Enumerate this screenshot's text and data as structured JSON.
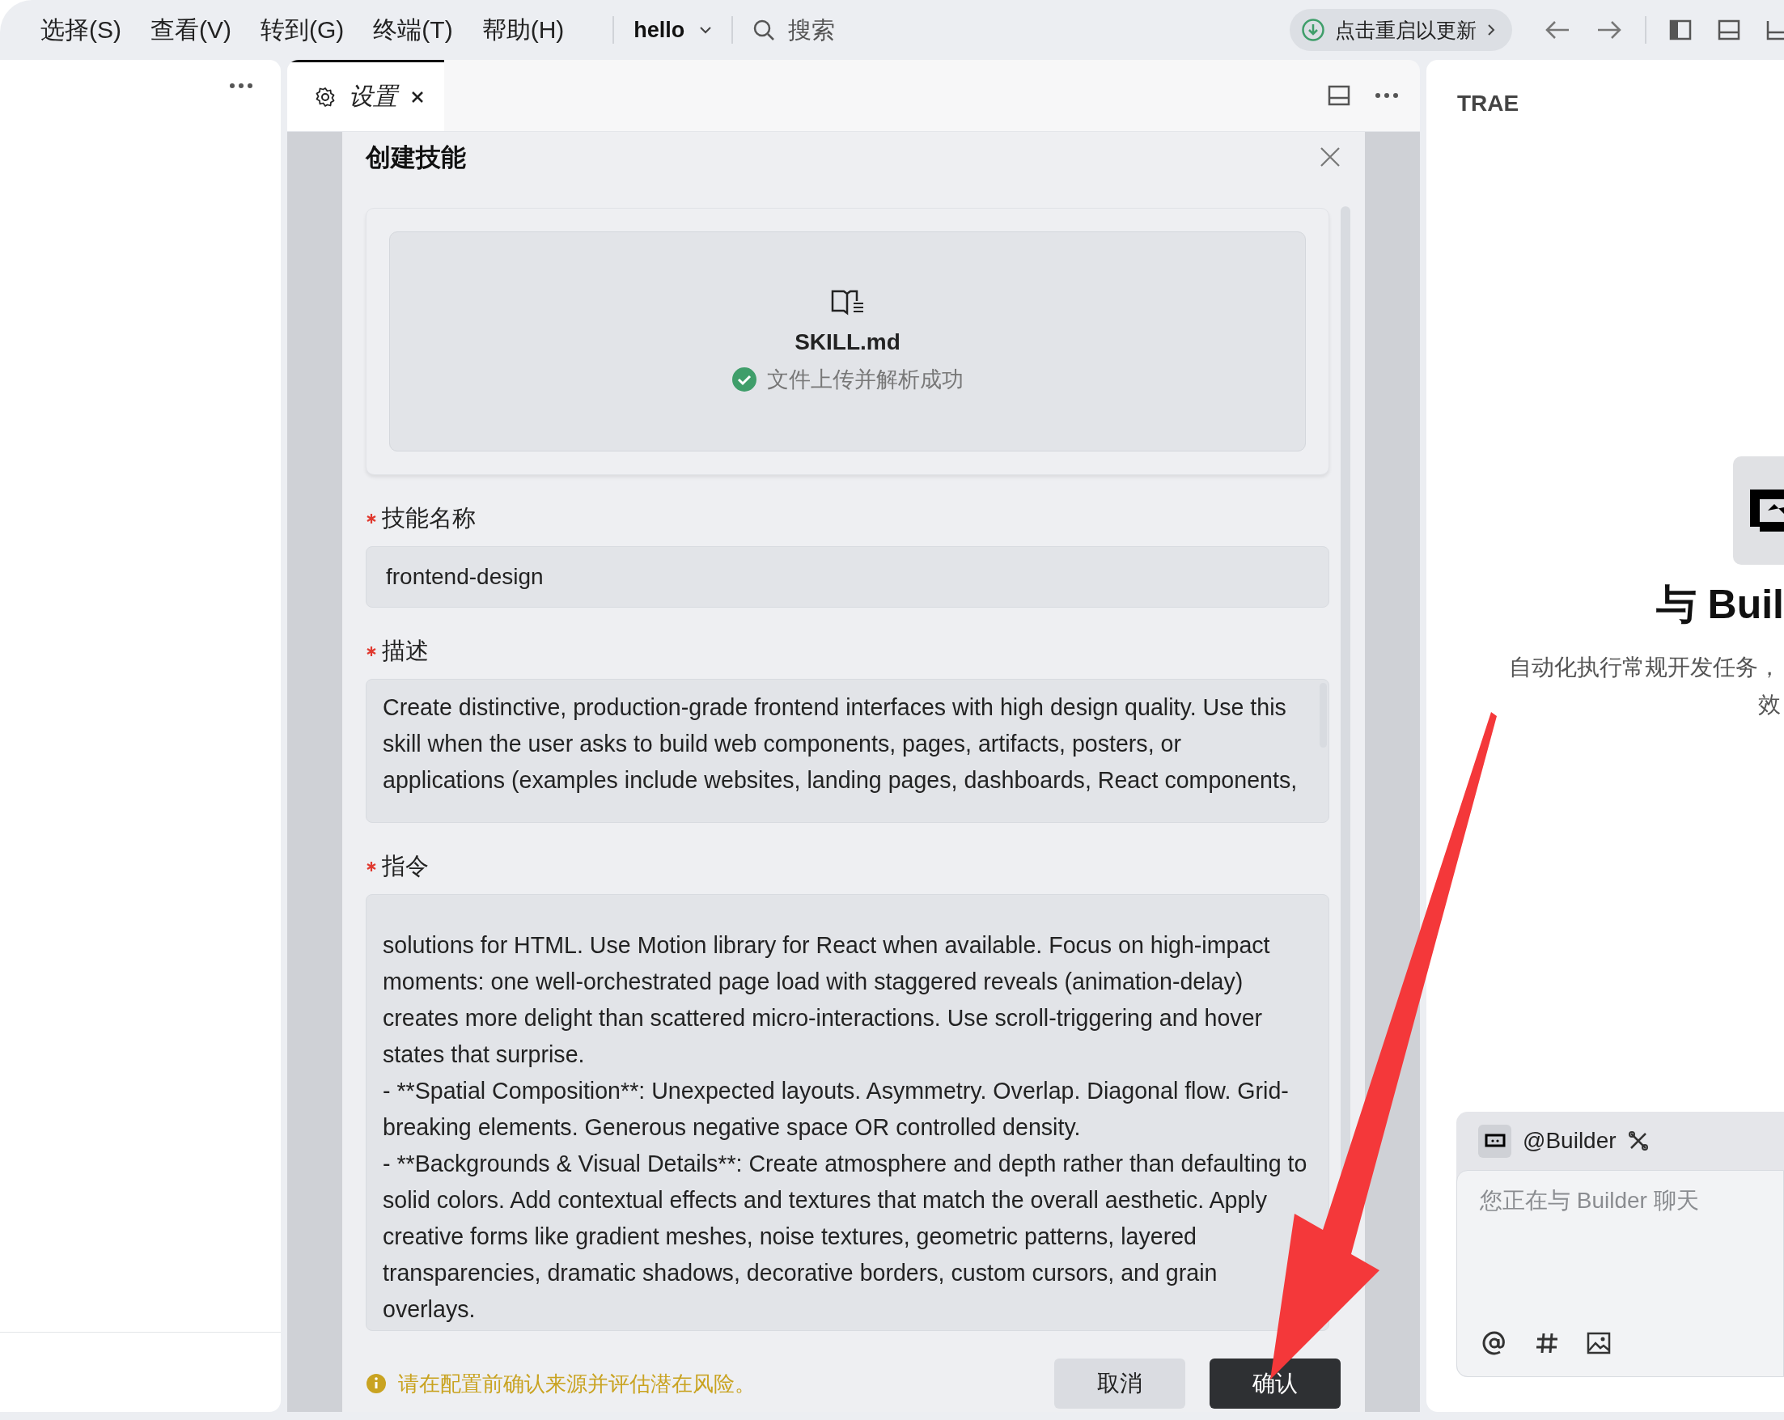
{
  "menu": [
    {
      "label": "选择(S)"
    },
    {
      "label": "查看(V)"
    },
    {
      "label": "转到(G)"
    },
    {
      "label": "终端(T)"
    },
    {
      "label": "帮助(H)"
    }
  ],
  "project": {
    "label": "hello"
  },
  "search": {
    "placeholder": "搜索"
  },
  "update_pill": {
    "label": "点击重启以更新"
  },
  "tabs": [
    {
      "label": "设置",
      "selected": true
    }
  ],
  "dialog": {
    "title": "创建技能",
    "upload": {
      "filename": "SKILL.md",
      "status": "文件上传并解析成功"
    },
    "fields": [
      {
        "label": "技能名称",
        "required": true,
        "kind": "input",
        "value": "frontend-design"
      },
      {
        "label": "描述",
        "required": true,
        "kind": "textarea",
        "value": "Create distinctive, production-grade frontend interfaces with high design quality. Use this skill when the user asks to build web components, pages, artifacts, posters, or applications (examples include websites, landing pages, dashboards, React components,"
      },
      {
        "label": "指令",
        "required": true,
        "kind": "textarea",
        "value": "solutions for HTML. Use Motion library for React when available. Focus on high-impact moments: one well-orchestrated page load with staggered reveals (animation-delay) creates more delight than scattered micro-interactions. Use scroll-triggering and hover states that surprise.\n- **Spatial Composition**: Unexpected layouts. Asymmetry. Overlap. Diagonal flow. Grid-breaking elements. Generous negative space OR controlled density.\n- **Backgrounds & Visual Details**: Create atmosphere and depth rather than defaulting to solid colors. Add contextual effects and textures that match the overall aesthetic. Apply creative forms like gradient meshes, noise textures, geometric patterns, layered transparencies, dramatic shadows, decorative borders, custom cursors, and grain overlays."
      }
    ],
    "warning": "请在配置前确认来源并评估潜在风险。",
    "buttons": [
      {
        "label": "取消",
        "kind": "secondary"
      },
      {
        "label": "确认",
        "kind": "primary"
      }
    ]
  },
  "right_panel": {
    "brand": "TRAE",
    "heading": "与 Buil",
    "subtitle": [
      "自动化执行常规开发任务，",
      "效"
    ],
    "chat": {
      "agent": "@Builder",
      "placeholder": "您正在与 Builder 聊天"
    }
  }
}
